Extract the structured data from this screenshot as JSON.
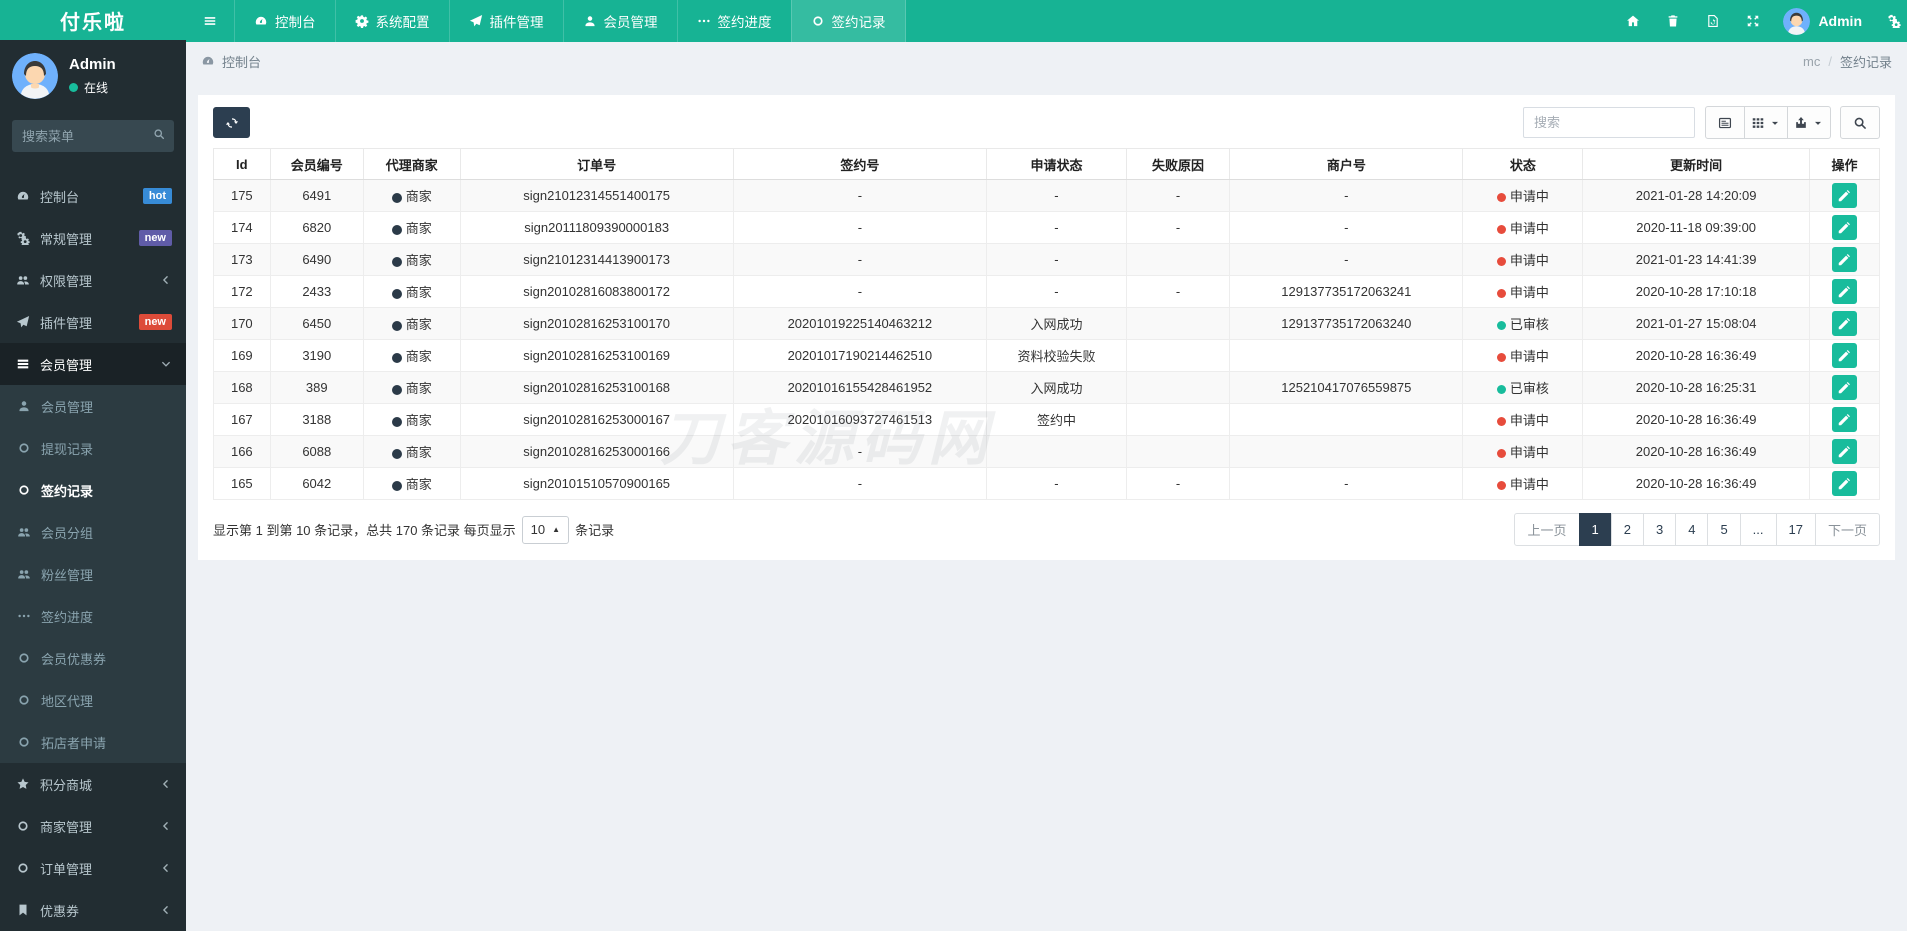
{
  "brand": {
    "logo": "付乐啦"
  },
  "user": {
    "name": "Admin",
    "status": "在线"
  },
  "sidebar": {
    "search_placeholder": "搜索菜单",
    "items": [
      {
        "label": "控制台",
        "icon": "gauge",
        "badge": "hot",
        "badge_color": "#378bd7"
      },
      {
        "label": "常规管理",
        "icon": "gears",
        "badge": "new",
        "badge_color": "#605ca8"
      },
      {
        "label": "权限管理",
        "icon": "users",
        "chevron": "left"
      },
      {
        "label": "插件管理",
        "icon": "rocket",
        "badge": "new",
        "badge_color": "#dd4b39"
      },
      {
        "label": "会员管理",
        "icon": "list",
        "chevron": "down",
        "active": true
      }
    ],
    "submenu": [
      {
        "label": "会员管理",
        "icon": "user"
      },
      {
        "label": "提现记录",
        "icon": "circle-o"
      },
      {
        "label": "签约记录",
        "icon": "circle-o",
        "active": true
      },
      {
        "label": "会员分组",
        "icon": "users"
      },
      {
        "label": "粉丝管理",
        "icon": "users"
      },
      {
        "label": "签约进度",
        "icon": "ellipsis"
      },
      {
        "label": "会员优惠券",
        "icon": "circle-o"
      },
      {
        "label": "地区代理",
        "icon": "circle-o"
      },
      {
        "label": "拓店者申请",
        "icon": "circle-o"
      }
    ],
    "items_bottom": [
      {
        "label": "积分商城",
        "icon": "star",
        "chevron": "left"
      },
      {
        "label": "商家管理",
        "icon": "circle-o",
        "chevron": "left"
      },
      {
        "label": "订单管理",
        "icon": "circle-o",
        "chevron": "left"
      },
      {
        "label": "优惠券",
        "icon": "bookmark",
        "chevron": "left"
      }
    ]
  },
  "topnav": {
    "tabs": [
      {
        "label": "控制台",
        "icon": "gauge"
      },
      {
        "label": "系统配置",
        "icon": "gear"
      },
      {
        "label": "插件管理",
        "icon": "rocket"
      },
      {
        "label": "会员管理",
        "icon": "user"
      },
      {
        "label": "签约进度",
        "icon": "ellipsis"
      },
      {
        "label": "签约记录",
        "icon": "circle-o",
        "active": true
      }
    ],
    "user_name": "Admin"
  },
  "breadcrumb": {
    "left": "控制台",
    "parent": "mc",
    "separator": "/",
    "current": "签约记录"
  },
  "toolbar": {
    "search_placeholder": "搜索"
  },
  "table": {
    "columns": [
      "Id",
      "会员编号",
      "代理商家",
      "订单号",
      "签约号",
      "申请状态",
      "失败原因",
      "商户号",
      "状态",
      "更新时间",
      "操作"
    ],
    "col_widths": [
      "3.4%",
      "5.6%",
      "5.8%",
      "16.4%",
      "15.2%",
      "8.4%",
      "6.2%",
      "14.0%",
      "7.2%",
      "13.6%",
      "4.2%"
    ],
    "agent_label": "商家",
    "rows": [
      {
        "id": "175",
        "member": "6491",
        "order": "sign21012314551400175",
        "sign": "-",
        "apply": "-",
        "fail": "-",
        "merchant_no": "-",
        "status": "申请中",
        "status_type": "red",
        "time": "2021-01-28 14:20:09"
      },
      {
        "id": "174",
        "member": "6820",
        "order": "sign20111809390000183",
        "sign": "-",
        "apply": "-",
        "fail": "-",
        "merchant_no": "-",
        "status": "申请中",
        "status_type": "red",
        "time": "2020-11-18 09:39:00"
      },
      {
        "id": "173",
        "member": "6490",
        "order": "sign21012314413900173",
        "sign": "-",
        "apply": "-",
        "fail": "",
        "merchant_no": "-",
        "status": "申请中",
        "status_type": "red",
        "time": "2021-01-23 14:41:39"
      },
      {
        "id": "172",
        "member": "2433",
        "order": "sign20102816083800172",
        "sign": "-",
        "apply": "-",
        "fail": "-",
        "merchant_no": "129137735172063241",
        "status": "申请中",
        "status_type": "red",
        "time": "2020-10-28 17:10:18"
      },
      {
        "id": "170",
        "member": "6450",
        "order": "sign20102816253100170",
        "sign": "20201019225140463212",
        "apply": "入网成功",
        "fail": "",
        "merchant_no": "129137735172063240",
        "status": "已审核",
        "status_type": "green",
        "time": "2021-01-27 15:08:04"
      },
      {
        "id": "169",
        "member": "3190",
        "order": "sign20102816253100169",
        "sign": "20201017190214462510",
        "apply": "资料校验失败",
        "fail": "",
        "merchant_no": "",
        "status": "申请中",
        "status_type": "red",
        "time": "2020-10-28 16:36:49"
      },
      {
        "id": "168",
        "member": "389",
        "order": "sign20102816253100168",
        "sign": "20201016155428461952",
        "apply": "入网成功",
        "fail": "",
        "merchant_no": "125210417076559875",
        "status": "已审核",
        "status_type": "green",
        "time": "2020-10-28 16:25:31"
      },
      {
        "id": "167",
        "member": "3188",
        "order": "sign20102816253000167",
        "sign": "20201016093727461513",
        "apply": "签约中",
        "fail": "",
        "merchant_no": "",
        "status": "申请中",
        "status_type": "red",
        "time": "2020-10-28 16:36:49"
      },
      {
        "id": "166",
        "member": "6088",
        "order": "sign20102816253000166",
        "sign": "-",
        "apply": "",
        "fail": "",
        "merchant_no": "",
        "status": "申请中",
        "status_type": "red",
        "time": "2020-10-28 16:36:49"
      },
      {
        "id": "165",
        "member": "6042",
        "order": "sign20101510570900165",
        "sign": "-",
        "apply": "-",
        "fail": "-",
        "merchant_no": "-",
        "status": "申请中",
        "status_type": "red",
        "time": "2020-10-28 16:36:49"
      }
    ]
  },
  "footer": {
    "summary_prefix": "显示第 1 到第 10 条记录，总共 170 条记录 每页显示",
    "page_size": "10",
    "summary_suffix": "条记录",
    "pagination": [
      "上一页",
      "1",
      "2",
      "3",
      "4",
      "5",
      "...",
      "17",
      "下一页"
    ],
    "active_page": "1"
  },
  "watermark": "刀客源码网",
  "colors": {
    "accent_green": "#17b394",
    "status_red": "#e74c3c",
    "status_green": "#18bc9c",
    "pagination_active": "#2c3e50"
  }
}
